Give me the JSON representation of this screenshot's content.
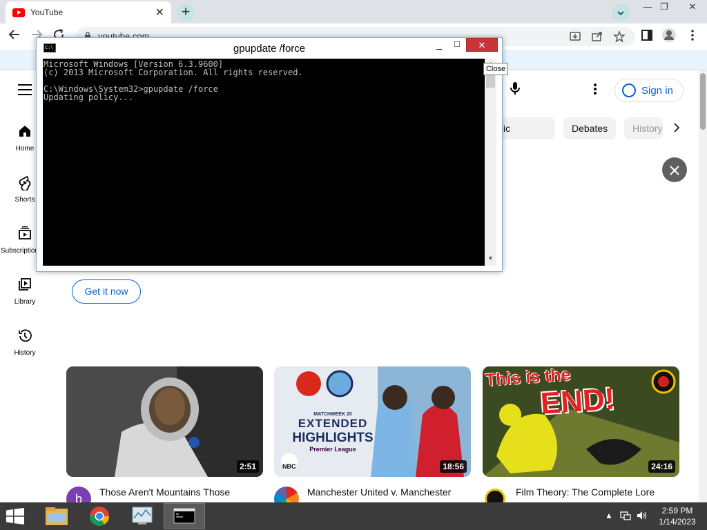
{
  "browser": {
    "tab_title": "YouTube",
    "tab_close": "✕",
    "new_tab": "+",
    "address": "youtube.com",
    "win_min": "—",
    "win_restore": "❐",
    "win_close": "✕"
  },
  "youtube": {
    "sign_in": "Sign in",
    "rail": [
      {
        "label": "Home",
        "icon": "home-icon"
      },
      {
        "label": "Shorts",
        "icon": "shorts-icon"
      },
      {
        "label": "Subscriptions",
        "icon": "subscriptions-icon"
      },
      {
        "label": "Library",
        "icon": "library-icon"
      },
      {
        "label": "History",
        "icon": "history-icon"
      }
    ],
    "chips": [
      "Background music",
      "Debates",
      "History"
    ],
    "get_it_now": "Get it now",
    "videos": [
      {
        "title": "Those Aren't Mountains Those",
        "duration": "2:51",
        "channel_initial": "b"
      },
      {
        "title": "Manchester United v. Manchester",
        "duration": "18:56",
        "channel_initial": ""
      },
      {
        "title": "Film Theory: The Complete Lore",
        "duration": "24:16",
        "channel_initial": ""
      }
    ],
    "thumb_texts": {
      "matchweek": "MATCHWEEK 20",
      "extended": "EXTENDED",
      "highlights": "HIGHLIGHTS",
      "premier": "Premier League",
      "nbc": "NBC",
      "end_line1": "This is the",
      "end_line2": "END!"
    }
  },
  "console": {
    "title": "gpupdate  /force",
    "icon_text": "C:\\_",
    "lines": [
      "Microsoft Windows [Version 6.3.9600]",
      "(c) 2013 Microsoft Corporation. All rights reserved.",
      "",
      "C:\\Windows\\System32>gpupdate /force",
      "Updating policy..."
    ],
    "tooltip": "Close",
    "min": "_",
    "max": "□",
    "close": "✕"
  },
  "taskbar": {
    "time": "2:59 PM",
    "date": "1/14/2023"
  },
  "colors": {
    "yt_red": "#ff0000",
    "yt_blue": "#065fd4",
    "close_red": "#c7343a",
    "taskbar": "#3b3b3b"
  }
}
